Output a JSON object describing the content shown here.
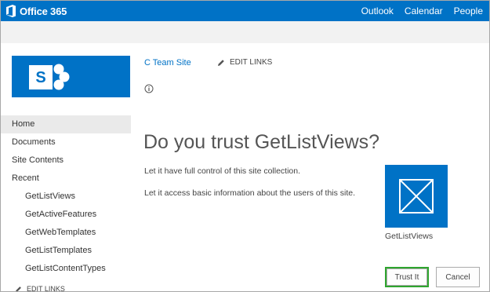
{
  "suite_bar": {
    "brand": "Office 365",
    "brand_icon": "office-logo-icon",
    "links": [
      "Outlook",
      "Calendar",
      "People"
    ],
    "color": "#0072c6"
  },
  "site": {
    "logo_icon": "sharepoint-logo-icon",
    "title": "C Team Site",
    "edit_links": "EDIT LINKS",
    "info_icon": "info-icon"
  },
  "nav": {
    "items": [
      "Home",
      "Documents",
      "Site Contents",
      "Recent"
    ],
    "recent": [
      "GetListViews",
      "GetActiveFeatures",
      "GetWebTemplates",
      "GetListTemplates",
      "GetListContentTypes"
    ],
    "edit_links": "EDIT LINKS"
  },
  "dialog": {
    "heading": "Do you trust GetListViews?",
    "permissions": [
      "Let it have full control of this site collection.",
      "Let it access basic information about the users of this site."
    ],
    "app_name": "GetListViews",
    "app_icon": "app-placeholder-icon",
    "trust_button": "Trust It",
    "cancel_button": "Cancel",
    "trust_outline_color": "#2fa52f"
  }
}
